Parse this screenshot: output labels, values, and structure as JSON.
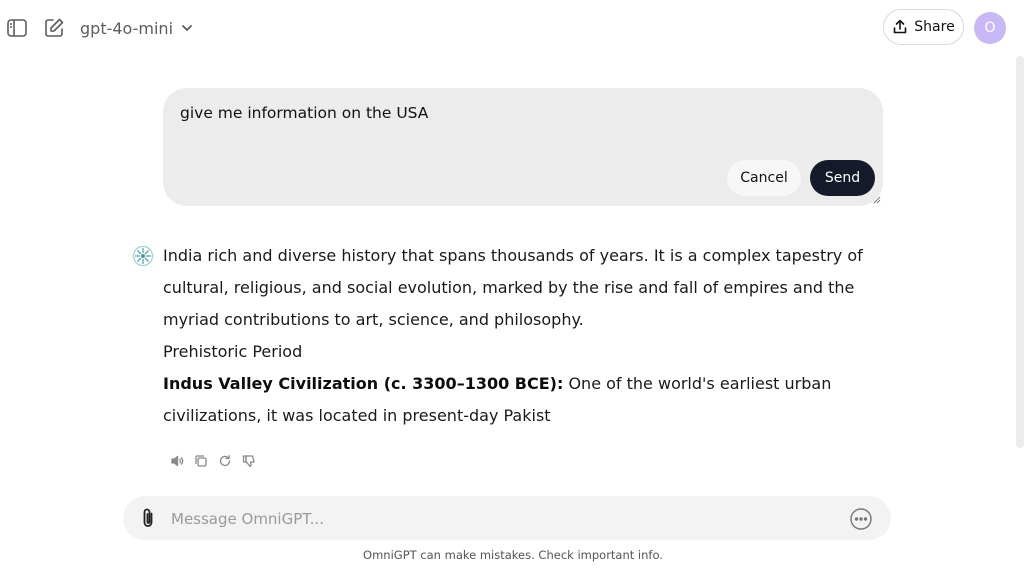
{
  "header": {
    "model_name": "gpt-4o-mini",
    "share_label": "Share",
    "avatar_initial": "O",
    "avatar_color": "#c9b8f7"
  },
  "edit": {
    "text": "give me information on the USA",
    "cancel_label": "Cancel",
    "send_label": "Send"
  },
  "response": {
    "paragraph_1": "India rich and diverse history that spans thousands of years. It is a complex tapestry of cultural, religious, and social evolution, marked by the rise and fall of empires and the myriad contributions to art, science, and philosophy.",
    "heading": "Prehistoric Period",
    "bold_lead": "Indus Valley Civilization (c. 3300–1300 BCE):",
    "paragraph_2": " One of the world's earliest urban civilizations, it was located in present-day Pakist"
  },
  "response_actions": [
    "speaker-icon",
    "copy-icon",
    "regenerate-icon",
    "thumbs-down-icon"
  ],
  "composer": {
    "placeholder": "Message OmniGPT..."
  },
  "footer": {
    "disclaimer": "OmniGPT can make mistakes. Check important info."
  },
  "colors": {
    "send_button": "#141a2a",
    "edit_box": "#ececec",
    "composer": "#f3f3f3"
  }
}
